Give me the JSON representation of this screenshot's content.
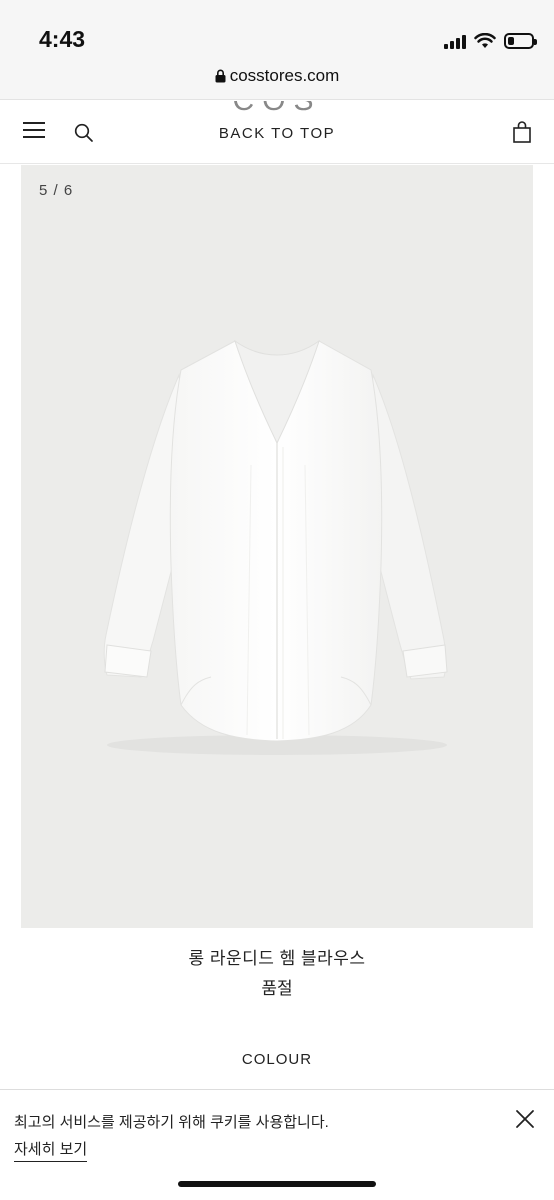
{
  "status_bar": {
    "time": "4:43",
    "icons": [
      "signal-icon",
      "wifi-icon",
      "battery-icon"
    ],
    "battery_level": 0.25
  },
  "browser": {
    "url": "cosstores.com",
    "lock_icon": "lock-icon"
  },
  "header": {
    "logo_text": "COS",
    "back_to_top": "BACK TO TOP",
    "menu_icon": "hamburger-menu-icon",
    "search_icon": "search-icon",
    "bag_icon": "shopping-bag-icon"
  },
  "gallery": {
    "counter": "5 / 6",
    "background": "#ececea"
  },
  "product": {
    "name": "롱 라운디드 헴 블라우스",
    "stock_status": "품절",
    "colour_label": "COLOUR"
  },
  "cookie_banner": {
    "message": "최고의 서비스를 제공하기 위해 쿠키를 사용합니다.",
    "details_link": "자세히 보기",
    "close_icon": "close-icon"
  }
}
